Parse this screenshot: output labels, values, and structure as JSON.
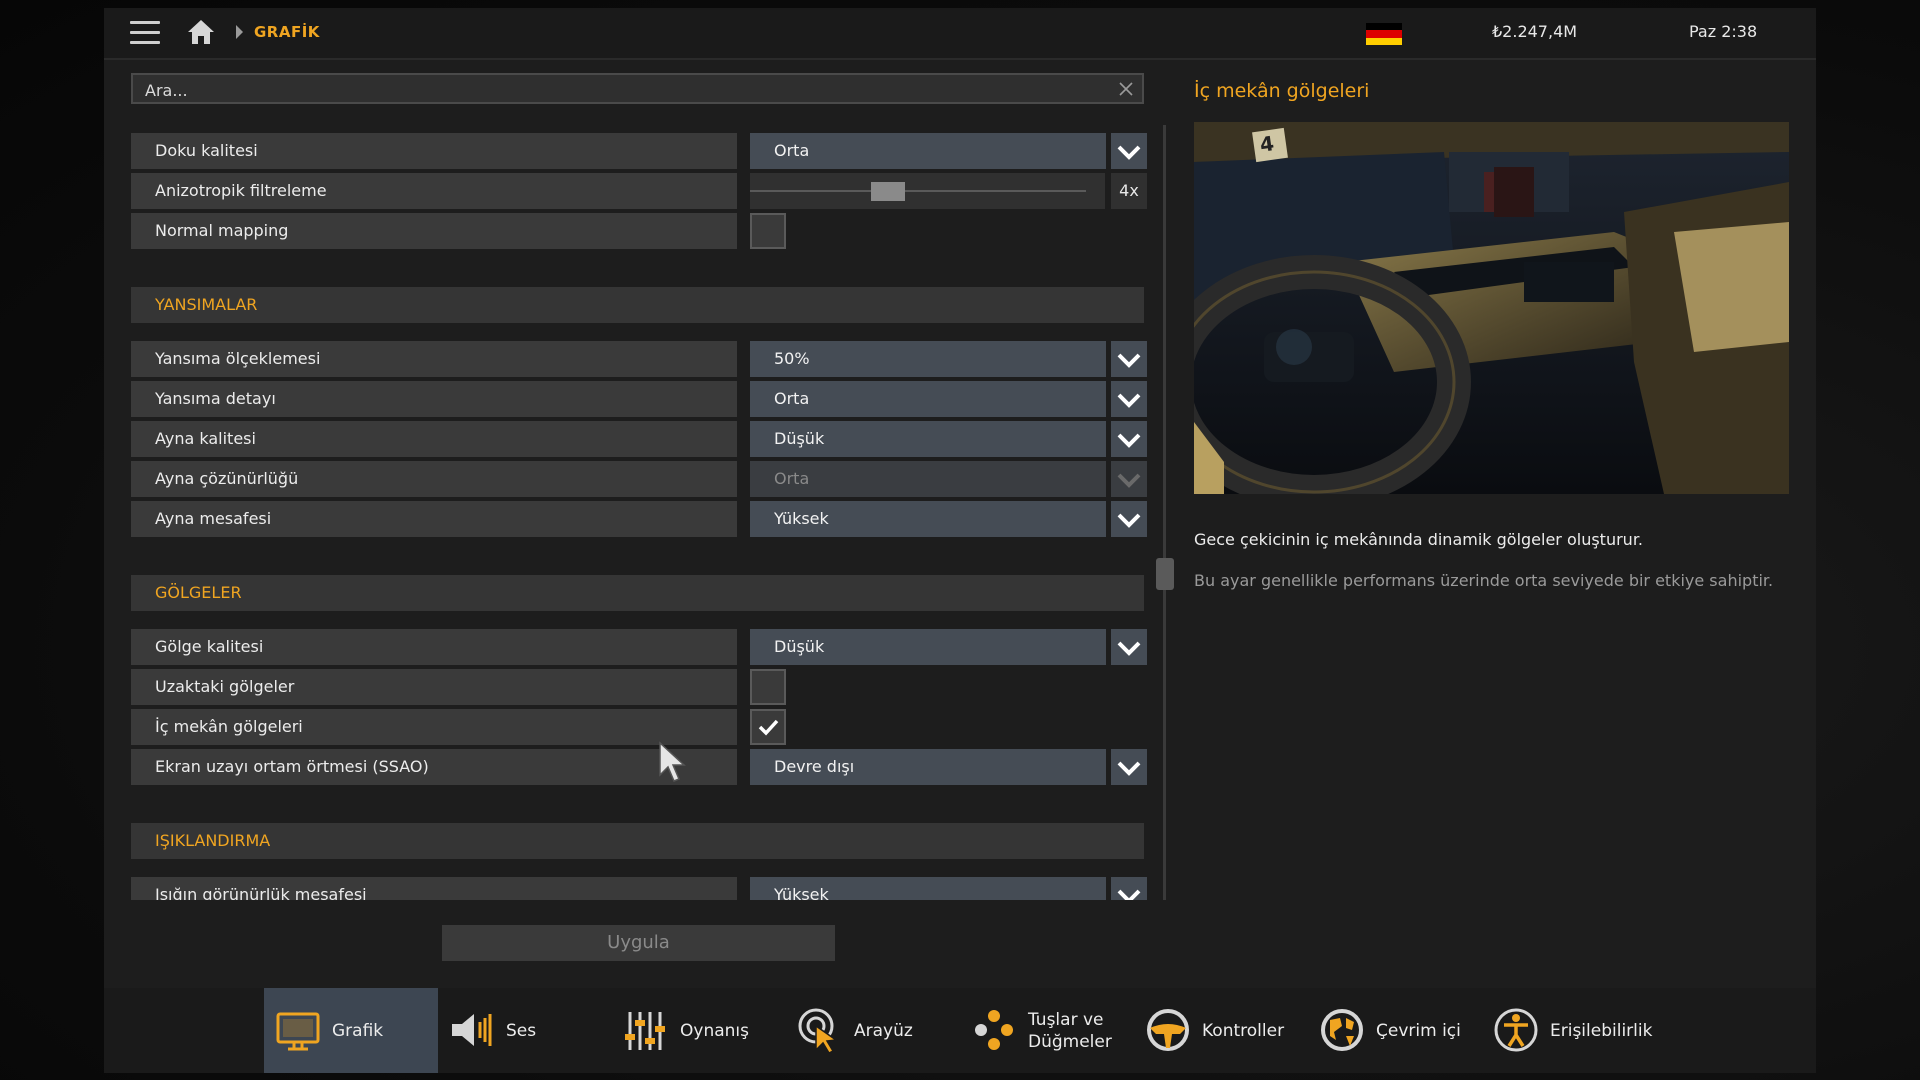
{
  "topbar": {
    "breadcrumb": "GRAFİK",
    "money": "₺2.247,4M",
    "clock": "Paz 2:38",
    "flag_colors": [
      "#000000",
      "#dd0000",
      "#ffce00"
    ]
  },
  "search": {
    "value": "Ara..."
  },
  "rows": [
    {
      "type": "dropdown",
      "label": "Doku kalitesi",
      "value": "Orta"
    },
    {
      "type": "slider",
      "label": "Anizotropik filtreleme",
      "value": "4x",
      "level": 0.4
    },
    {
      "type": "checkbox",
      "label": "Normal mapping",
      "checked": false
    },
    {
      "type": "section",
      "label": "YANSIMALAR"
    },
    {
      "type": "dropdown",
      "label": "Yansıma ölçeklemesi",
      "value": "50%"
    },
    {
      "type": "dropdown",
      "label": "Yansıma detayı",
      "value": "Orta"
    },
    {
      "type": "dropdown",
      "label": "Ayna kalitesi",
      "value": "Düşük"
    },
    {
      "type": "dropdown",
      "label": "Ayna çözünürlüğü",
      "value": "Orta",
      "disabled": true
    },
    {
      "type": "dropdown",
      "label": "Ayna mesafesi",
      "value": "Yüksek"
    },
    {
      "type": "section",
      "label": "GÖLGELER"
    },
    {
      "type": "dropdown",
      "label": "Gölge kalitesi",
      "value": "Düşük"
    },
    {
      "type": "checkbox",
      "label": "Uzaktaki gölgeler",
      "checked": false
    },
    {
      "type": "checkbox",
      "label": "İç mekân gölgeleri",
      "checked": true
    },
    {
      "type": "dropdown",
      "label": "Ekran uzayı ortam örtmesi (SSAO)",
      "value": "Devre dışı"
    },
    {
      "type": "section",
      "label": "IŞIKLANDIRMA"
    },
    {
      "type": "dropdown",
      "label": "Işığın görünürlük mesafesi",
      "value": "Yüksek"
    }
  ],
  "apply_label": "Uygula",
  "info": {
    "title": "İç mekân gölgeleri",
    "badge": "4",
    "description": "Gece çekicinin iç mekânında dinamik gölgeler oluşturur.",
    "performance": "Bu ayar genellikle performans üzerinde orta seviyede bir etkiye sahiptir."
  },
  "nav": [
    {
      "label": "Grafik",
      "icon": "monitor-icon",
      "active": true
    },
    {
      "label": "Ses",
      "icon": "speaker-icon",
      "active": false
    },
    {
      "label": "Oynanış",
      "icon": "sliders-icon",
      "active": false
    },
    {
      "label": "Arayüz",
      "icon": "cursor-target-icon",
      "active": false
    },
    {
      "label": "Tuşlar ve Düğmeler",
      "icon": "gamepad-buttons-icon",
      "active": false
    },
    {
      "label": "Kontroller",
      "icon": "steering-wheel-icon",
      "active": false
    },
    {
      "label": "Çevrim içi",
      "icon": "globe-icon",
      "active": false
    },
    {
      "label": "Erişilebilirlik",
      "icon": "accessibility-icon",
      "active": false
    }
  ],
  "colors": {
    "accent": "#f0a521",
    "active_tab": "#3d4652",
    "dropdown": "#454c55"
  }
}
